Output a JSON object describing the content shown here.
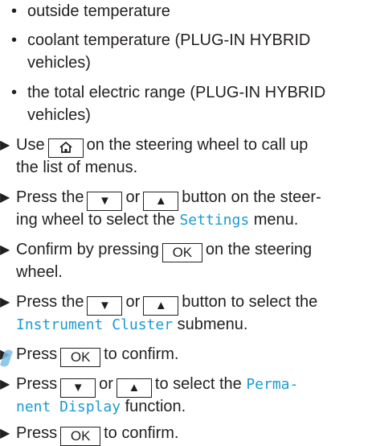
{
  "bullets": [
    "outside temperature",
    "coolant temperature (PLUG-IN HYBRID",
    "vehicles)",
    "the total electric range (PLUG-IN HYBRID",
    "vehicles)"
  ],
  "icons": {
    "step_marker": "triangle-right-icon",
    "home": "home-icon",
    "down": "down-arrow-icon",
    "up": "up-arrow-icon"
  },
  "keys": {
    "ok": "OK",
    "down": "▼",
    "up": "▲"
  },
  "steps": {
    "s1": {
      "a": "Use",
      "b": "on the steering wheel to call up",
      "c": "the list of menus."
    },
    "s2": {
      "a": "Press the",
      "or": "or",
      "b": "button on the steer-",
      "c": "ing wheel to select the",
      "menu": "Settings",
      "d": "menu."
    },
    "s3": {
      "a": "Confirm by pressing",
      "b": "on the steering",
      "c": "wheel."
    },
    "s4": {
      "a": "Press the",
      "or": "or",
      "b": "button to select the",
      "submenu": "Instrument Cluster",
      "c": "submenu."
    },
    "s5": {
      "a": "Press",
      "b": "to confirm."
    },
    "s6": {
      "a": "Press",
      "or": "or",
      "b": "to select the",
      "func1": "Perma-",
      "func2": "nent Display",
      "c": "function."
    },
    "s7": {
      "a": "Press",
      "b": "to confirm."
    }
  },
  "colors": {
    "text": "#231f20",
    "highlight": "#1a9bd3"
  }
}
